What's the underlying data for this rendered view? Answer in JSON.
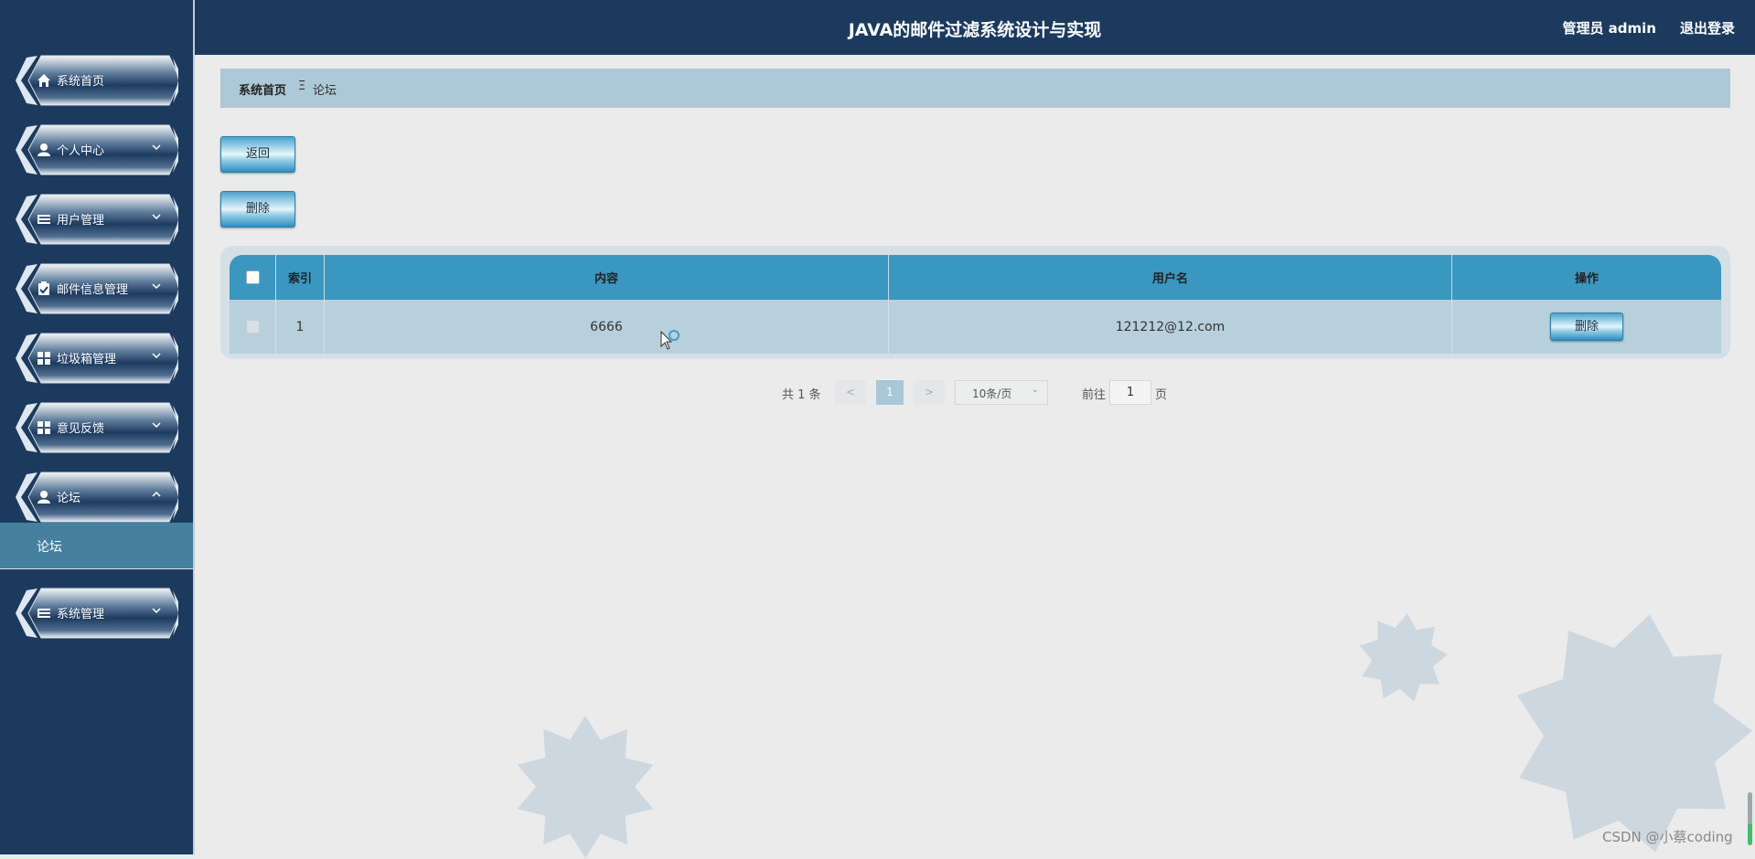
{
  "app": {
    "title": "JAVA的邮件过滤系统设计与实现",
    "user_label": "管理员 admin",
    "logout_label": "退出登录"
  },
  "sidebar": {
    "items": [
      {
        "label": "系统首页",
        "icon": "home-icon",
        "expandable": false
      },
      {
        "label": "个人中心",
        "icon": "user-icon",
        "expandable": true
      },
      {
        "label": "用户管理",
        "icon": "list-icon",
        "expandable": true
      },
      {
        "label": "邮件信息管理",
        "icon": "clipboard-check-icon",
        "expandable": true
      },
      {
        "label": "垃圾箱管理",
        "icon": "grid-icon",
        "expandable": true
      },
      {
        "label": "意见反馈",
        "icon": "grid-icon",
        "expandable": true
      },
      {
        "label": "论坛",
        "icon": "user-icon",
        "expandable": true,
        "expanded": true
      },
      {
        "label": "系统管理",
        "icon": "list-icon",
        "expandable": true
      }
    ],
    "submenu": {
      "label": "论坛"
    }
  },
  "breadcrumb": {
    "home": "系统首页",
    "separator": "Ξ",
    "current": "论坛"
  },
  "actions": {
    "back_label": "返回",
    "delete_label": "删除"
  },
  "table": {
    "columns": [
      "索引",
      "内容",
      "用户名",
      "操作"
    ],
    "rows": [
      {
        "index": "1",
        "content": "6666",
        "username": "121212@12.com",
        "action_label": "删除"
      }
    ]
  },
  "pagination": {
    "total_text": "共 1 条",
    "prev": "<",
    "next": ">",
    "current_page": "1",
    "page_size": "10条/页",
    "goto_label": "前往",
    "goto_value": "1",
    "page_word": "页"
  },
  "watermark": "CSDN @小蔡coding",
  "colors": {
    "sidebar_bg": "#1b3a5e",
    "header_bg": "#1b3a5e",
    "breadcrumb_bg": "#adc8d6",
    "table_header_bg": "#3a97c0",
    "table_row_bg": "#b8d0dc",
    "submenu_bg": "#45809f",
    "page_bg": "#ebebeb"
  }
}
